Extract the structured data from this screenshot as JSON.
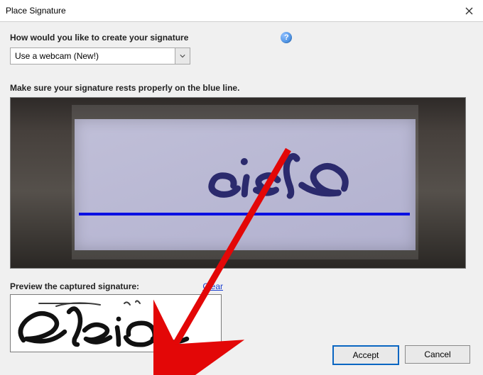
{
  "window": {
    "title": "Place Signature"
  },
  "prompt": {
    "label": "How would you like to create your signature",
    "help_glyph": "?"
  },
  "method_select": {
    "value": "Use a webcam (New!)"
  },
  "instruction": "Make sure your signature rests properly on the blue line.",
  "webcam": {
    "signature_text": "Elsie"
  },
  "preview": {
    "label": "Preview the captured signature:",
    "clear_label": "Clear",
    "signature_text": "Elsie"
  },
  "buttons": {
    "accept": "Accept",
    "cancel": "Cancel"
  }
}
